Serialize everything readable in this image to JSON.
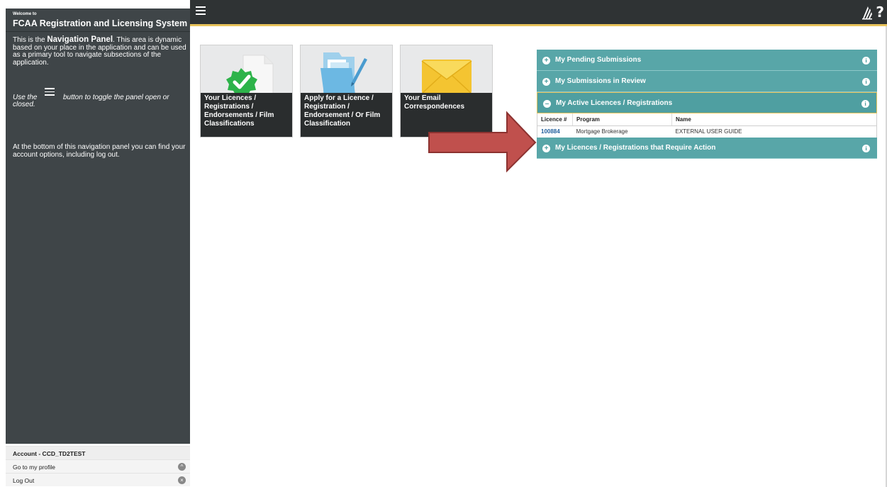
{
  "sidebar": {
    "welcome": "Welcome to",
    "title": "FCAA Registration and Licensing System",
    "intro_prefix": "This is the ",
    "intro_bold": "Navigation Panel",
    "intro_suffix": ". This area is dynamic based on your place in the application and can be used as a primary tool to navigate subsections of the application.",
    "toggle_prefix": "Use the",
    "toggle_suffix": "button to toggle the panel open or",
    "toggle_end": "closed.",
    "bottom_note": "At the bottom of this navigation panel you can find your account options, including log out.",
    "account": {
      "header": "Account - CCD_TD2TEST",
      "profile_label": "Go to my profile",
      "logout_label": "Log Out"
    }
  },
  "tiles": [
    {
      "label": "Your Licences / Registrations / Endorsements / Film Classifications"
    },
    {
      "label": "Apply for a Licence / Registration / Endorsement / Or Film Classification"
    },
    {
      "label": "Your Email Correspondences"
    }
  ],
  "accordion": {
    "pending": "My Pending Submissions",
    "review": "My Submissions in Review",
    "active": "My Active Licences / Registrations",
    "action": "My Licences / Registrations that Require Action"
  },
  "licence_table": {
    "headers": [
      "Licence #",
      "Program",
      "Name"
    ],
    "rows": [
      {
        "licence": "100884",
        "program": "Mortgage Brokerage",
        "name": "EXTERNAL USER GUIDE"
      }
    ]
  },
  "colors": {
    "accent": "#e7c25a",
    "teal": "#58a6a8",
    "arrow": "#c0504d",
    "sidebar_bg": "#3f4548"
  },
  "icons": [
    "hamburger-icon",
    "logo-icon",
    "help-icon",
    "check-badge-icon",
    "folder-pen-icon",
    "envelope-icon",
    "plus-icon",
    "minus-icon",
    "info-icon",
    "up-icon",
    "close-icon"
  ]
}
